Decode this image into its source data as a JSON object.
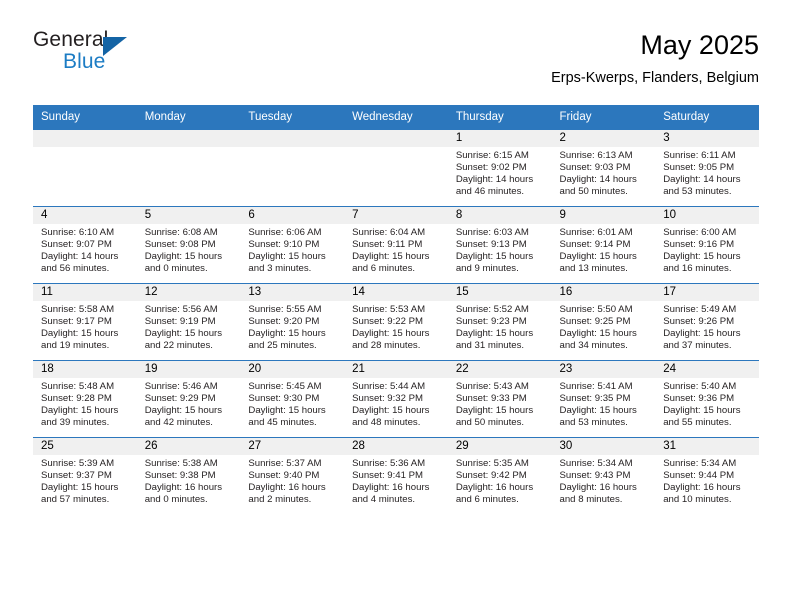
{
  "brand": {
    "name_part1": "General",
    "name_part2": "Blue",
    "triangle_color": "#1464a5",
    "blue_text_color": "#1c7cc4"
  },
  "header": {
    "title": "May 2025",
    "subtitle": "Erps-Kwerps, Flanders, Belgium"
  },
  "theme": {
    "header_row_bg": "#2c77bd",
    "header_row_text": "#ffffff",
    "daynum_band_bg": "#f0f0f0",
    "grid_line": "#2c77bd",
    "cell_bg": "#ffffff",
    "body_text": "#231f20"
  },
  "calendar": {
    "weekday_headers": [
      "Sunday",
      "Monday",
      "Tuesday",
      "Wednesday",
      "Thursday",
      "Friday",
      "Saturday"
    ],
    "weeks": [
      [
        {
          "day": "",
          "empty": true
        },
        {
          "day": "",
          "empty": true
        },
        {
          "day": "",
          "empty": true
        },
        {
          "day": "",
          "empty": true
        },
        {
          "day": "1",
          "sunrise": "Sunrise: 6:15 AM",
          "sunset": "Sunset: 9:02 PM",
          "daylight_line1": "Daylight: 14 hours",
          "daylight_line2": "and 46 minutes."
        },
        {
          "day": "2",
          "sunrise": "Sunrise: 6:13 AM",
          "sunset": "Sunset: 9:03 PM",
          "daylight_line1": "Daylight: 14 hours",
          "daylight_line2": "and 50 minutes."
        },
        {
          "day": "3",
          "sunrise": "Sunrise: 6:11 AM",
          "sunset": "Sunset: 9:05 PM",
          "daylight_line1": "Daylight: 14 hours",
          "daylight_line2": "and 53 minutes."
        }
      ],
      [
        {
          "day": "4",
          "sunrise": "Sunrise: 6:10 AM",
          "sunset": "Sunset: 9:07 PM",
          "daylight_line1": "Daylight: 14 hours",
          "daylight_line2": "and 56 minutes."
        },
        {
          "day": "5",
          "sunrise": "Sunrise: 6:08 AM",
          "sunset": "Sunset: 9:08 PM",
          "daylight_line1": "Daylight: 15 hours",
          "daylight_line2": "and 0 minutes."
        },
        {
          "day": "6",
          "sunrise": "Sunrise: 6:06 AM",
          "sunset": "Sunset: 9:10 PM",
          "daylight_line1": "Daylight: 15 hours",
          "daylight_line2": "and 3 minutes."
        },
        {
          "day": "7",
          "sunrise": "Sunrise: 6:04 AM",
          "sunset": "Sunset: 9:11 PM",
          "daylight_line1": "Daylight: 15 hours",
          "daylight_line2": "and 6 minutes."
        },
        {
          "day": "8",
          "sunrise": "Sunrise: 6:03 AM",
          "sunset": "Sunset: 9:13 PM",
          "daylight_line1": "Daylight: 15 hours",
          "daylight_line2": "and 9 minutes."
        },
        {
          "day": "9",
          "sunrise": "Sunrise: 6:01 AM",
          "sunset": "Sunset: 9:14 PM",
          "daylight_line1": "Daylight: 15 hours",
          "daylight_line2": "and 13 minutes."
        },
        {
          "day": "10",
          "sunrise": "Sunrise: 6:00 AM",
          "sunset": "Sunset: 9:16 PM",
          "daylight_line1": "Daylight: 15 hours",
          "daylight_line2": "and 16 minutes."
        }
      ],
      [
        {
          "day": "11",
          "sunrise": "Sunrise: 5:58 AM",
          "sunset": "Sunset: 9:17 PM",
          "daylight_line1": "Daylight: 15 hours",
          "daylight_line2": "and 19 minutes."
        },
        {
          "day": "12",
          "sunrise": "Sunrise: 5:56 AM",
          "sunset": "Sunset: 9:19 PM",
          "daylight_line1": "Daylight: 15 hours",
          "daylight_line2": "and 22 minutes."
        },
        {
          "day": "13",
          "sunrise": "Sunrise: 5:55 AM",
          "sunset": "Sunset: 9:20 PM",
          "daylight_line1": "Daylight: 15 hours",
          "daylight_line2": "and 25 minutes."
        },
        {
          "day": "14",
          "sunrise": "Sunrise: 5:53 AM",
          "sunset": "Sunset: 9:22 PM",
          "daylight_line1": "Daylight: 15 hours",
          "daylight_line2": "and 28 minutes."
        },
        {
          "day": "15",
          "sunrise": "Sunrise: 5:52 AM",
          "sunset": "Sunset: 9:23 PM",
          "daylight_line1": "Daylight: 15 hours",
          "daylight_line2": "and 31 minutes."
        },
        {
          "day": "16",
          "sunrise": "Sunrise: 5:50 AM",
          "sunset": "Sunset: 9:25 PM",
          "daylight_line1": "Daylight: 15 hours",
          "daylight_line2": "and 34 minutes."
        },
        {
          "day": "17",
          "sunrise": "Sunrise: 5:49 AM",
          "sunset": "Sunset: 9:26 PM",
          "daylight_line1": "Daylight: 15 hours",
          "daylight_line2": "and 37 minutes."
        }
      ],
      [
        {
          "day": "18",
          "sunrise": "Sunrise: 5:48 AM",
          "sunset": "Sunset: 9:28 PM",
          "daylight_line1": "Daylight: 15 hours",
          "daylight_line2": "and 39 minutes."
        },
        {
          "day": "19",
          "sunrise": "Sunrise: 5:46 AM",
          "sunset": "Sunset: 9:29 PM",
          "daylight_line1": "Daylight: 15 hours",
          "daylight_line2": "and 42 minutes."
        },
        {
          "day": "20",
          "sunrise": "Sunrise: 5:45 AM",
          "sunset": "Sunset: 9:30 PM",
          "daylight_line1": "Daylight: 15 hours",
          "daylight_line2": "and 45 minutes."
        },
        {
          "day": "21",
          "sunrise": "Sunrise: 5:44 AM",
          "sunset": "Sunset: 9:32 PM",
          "daylight_line1": "Daylight: 15 hours",
          "daylight_line2": "and 48 minutes."
        },
        {
          "day": "22",
          "sunrise": "Sunrise: 5:43 AM",
          "sunset": "Sunset: 9:33 PM",
          "daylight_line1": "Daylight: 15 hours",
          "daylight_line2": "and 50 minutes."
        },
        {
          "day": "23",
          "sunrise": "Sunrise: 5:41 AM",
          "sunset": "Sunset: 9:35 PM",
          "daylight_line1": "Daylight: 15 hours",
          "daylight_line2": "and 53 minutes."
        },
        {
          "day": "24",
          "sunrise": "Sunrise: 5:40 AM",
          "sunset": "Sunset: 9:36 PM",
          "daylight_line1": "Daylight: 15 hours",
          "daylight_line2": "and 55 minutes."
        }
      ],
      [
        {
          "day": "25",
          "sunrise": "Sunrise: 5:39 AM",
          "sunset": "Sunset: 9:37 PM",
          "daylight_line1": "Daylight: 15 hours",
          "daylight_line2": "and 57 minutes."
        },
        {
          "day": "26",
          "sunrise": "Sunrise: 5:38 AM",
          "sunset": "Sunset: 9:38 PM",
          "daylight_line1": "Daylight: 16 hours",
          "daylight_line2": "and 0 minutes."
        },
        {
          "day": "27",
          "sunrise": "Sunrise: 5:37 AM",
          "sunset": "Sunset: 9:40 PM",
          "daylight_line1": "Daylight: 16 hours",
          "daylight_line2": "and 2 minutes."
        },
        {
          "day": "28",
          "sunrise": "Sunrise: 5:36 AM",
          "sunset": "Sunset: 9:41 PM",
          "daylight_line1": "Daylight: 16 hours",
          "daylight_line2": "and 4 minutes."
        },
        {
          "day": "29",
          "sunrise": "Sunrise: 5:35 AM",
          "sunset": "Sunset: 9:42 PM",
          "daylight_line1": "Daylight: 16 hours",
          "daylight_line2": "and 6 minutes."
        },
        {
          "day": "30",
          "sunrise": "Sunrise: 5:34 AM",
          "sunset": "Sunset: 9:43 PM",
          "daylight_line1": "Daylight: 16 hours",
          "daylight_line2": "and 8 minutes."
        },
        {
          "day": "31",
          "sunrise": "Sunrise: 5:34 AM",
          "sunset": "Sunset: 9:44 PM",
          "daylight_line1": "Daylight: 16 hours",
          "daylight_line2": "and 10 minutes."
        }
      ]
    ]
  }
}
